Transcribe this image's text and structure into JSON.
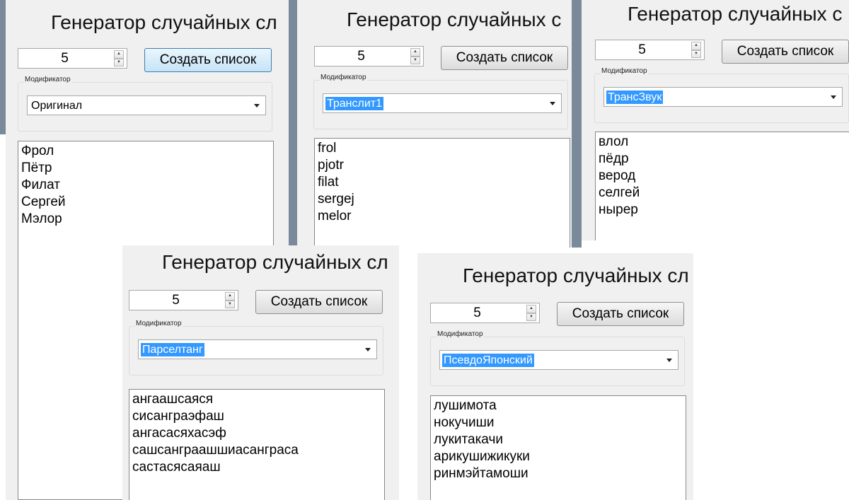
{
  "windows": [
    {
      "title": "Генератор случайных сл",
      "count": "5",
      "create_button": "Создать список",
      "modifier_caption": "Модификатор",
      "modifier_selected": "Оригинал",
      "items": [
        "Фрол",
        "Пётр",
        "Филат",
        "Сергей",
        "Мэлор"
      ]
    },
    {
      "title": "Генератор случайных с",
      "count": "5",
      "create_button": "Создать список",
      "modifier_caption": "Модификатор",
      "modifier_selected": "Транслит1",
      "items": [
        "frol",
        "pjotr",
        "filat",
        "sergej",
        "melor"
      ]
    },
    {
      "title": "Генератор случайных с",
      "count": "5",
      "create_button": "Создать список",
      "modifier_caption": "Модификатор",
      "modifier_selected": "ТрансЗвук",
      "items": [
        "влол",
        "пёдр",
        "верод",
        "селгей",
        "нырер"
      ]
    },
    {
      "title": "Генератор случайных сл",
      "count": "5",
      "create_button": "Создать список",
      "modifier_caption": "Модификатор",
      "modifier_selected": "Парселтанг",
      "items": [
        "ангаашсаяся",
        "сисанграэфаш",
        "ангасасяхасэф",
        "сашсанграашшиасанграса",
        "састасясаяаш"
      ]
    },
    {
      "title": "Генератор случайных сл",
      "count": "5",
      "create_button": "Создать список",
      "modifier_caption": "Модификатор",
      "modifier_selected": "ПсевдоЯпонский",
      "items": [
        "лушимота",
        "нокучиши",
        "лукитакачи",
        "арикушижикуки",
        "ринмэйтамоши"
      ]
    }
  ]
}
